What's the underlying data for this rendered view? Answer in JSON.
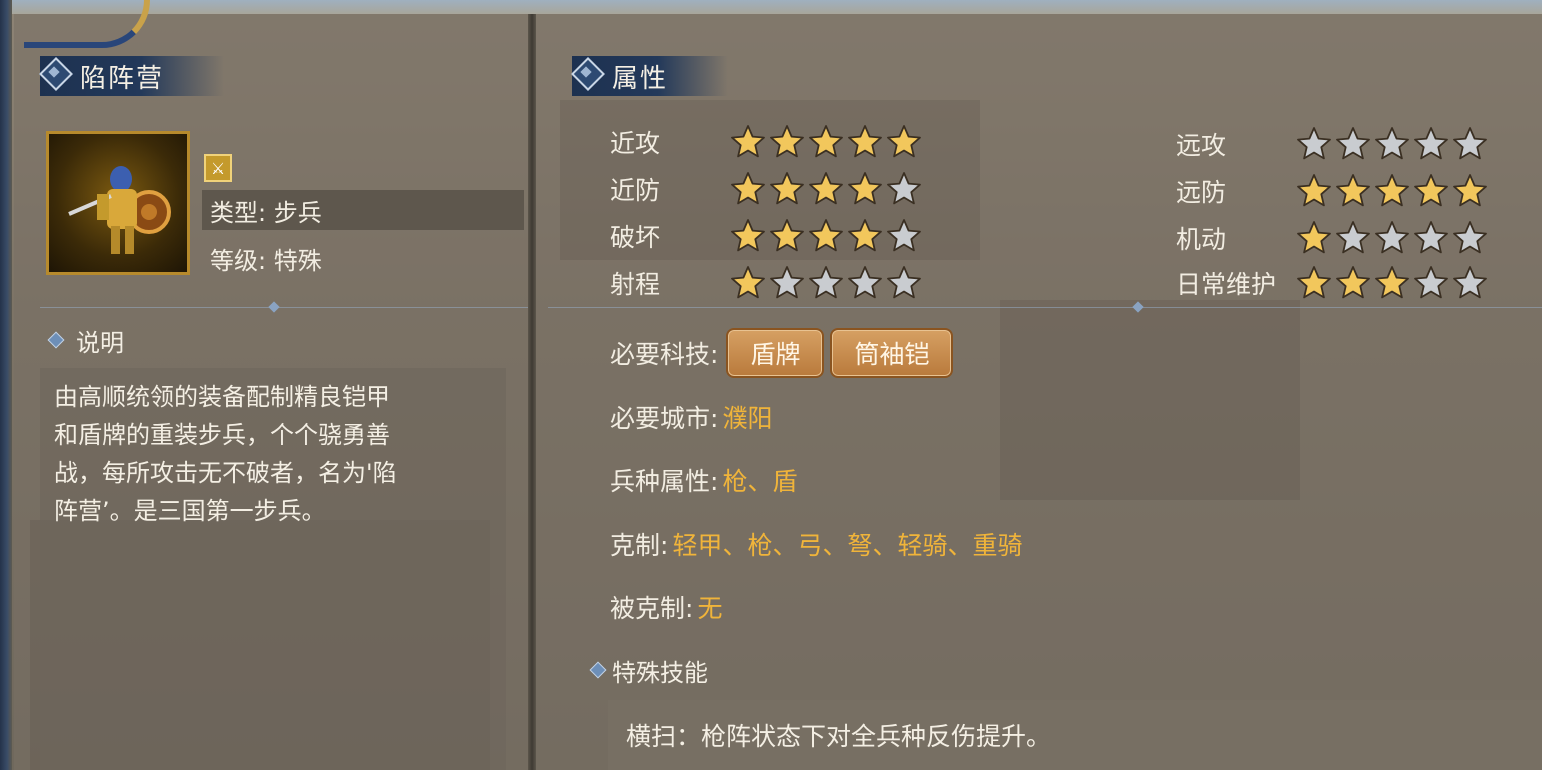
{
  "unit": {
    "name": "陷阵营",
    "type_label": "类型: 步兵",
    "level_label": "等级: 特殊",
    "portrait_icon": "armored-infantry-shield",
    "class_icon": "sword-badge-icon"
  },
  "description": {
    "heading": "说明",
    "lines": [
      "由高顺统领的装备配制精良铠甲",
      "和盾牌的重装步兵，个个骁勇善",
      "战，每所攻击无不破者，名为'陷",
      "阵营’。是三国第一步兵。"
    ]
  },
  "attributes": {
    "heading": "属性",
    "max_stars": 5,
    "left": [
      {
        "label": "近攻",
        "stars": 5
      },
      {
        "label": "近防",
        "stars": 4
      },
      {
        "label": "破坏",
        "stars": 4
      },
      {
        "label": "射程",
        "stars": 1
      }
    ],
    "right": [
      {
        "label": "远攻",
        "stars": 0
      },
      {
        "label": "远防",
        "stars": 5
      },
      {
        "label": "机动",
        "stars": 1
      },
      {
        "label": "日常维护",
        "stars": 3
      }
    ]
  },
  "properties": {
    "tech_label": "必要科技:",
    "techs": [
      "盾牌",
      "筒袖铠"
    ],
    "city_label": "必要城市:",
    "city": "濮阳",
    "trait_label": "兵种属性:",
    "trait": "枪、盾",
    "counters_label": "克制:",
    "counters": "轻甲、枪、弓、弩、轻骑、重骑",
    "countered_label": "被克制:",
    "countered": "无"
  },
  "special": {
    "heading": "特殊技能",
    "text": "横扫：枪阵状态下对全兵种反伤提升。"
  },
  "colors": {
    "star_filled": "#f2c75c",
    "star_empty": "#c9ccd0",
    "highlight": "#f0b43a",
    "title_bar": "#1d3150"
  }
}
